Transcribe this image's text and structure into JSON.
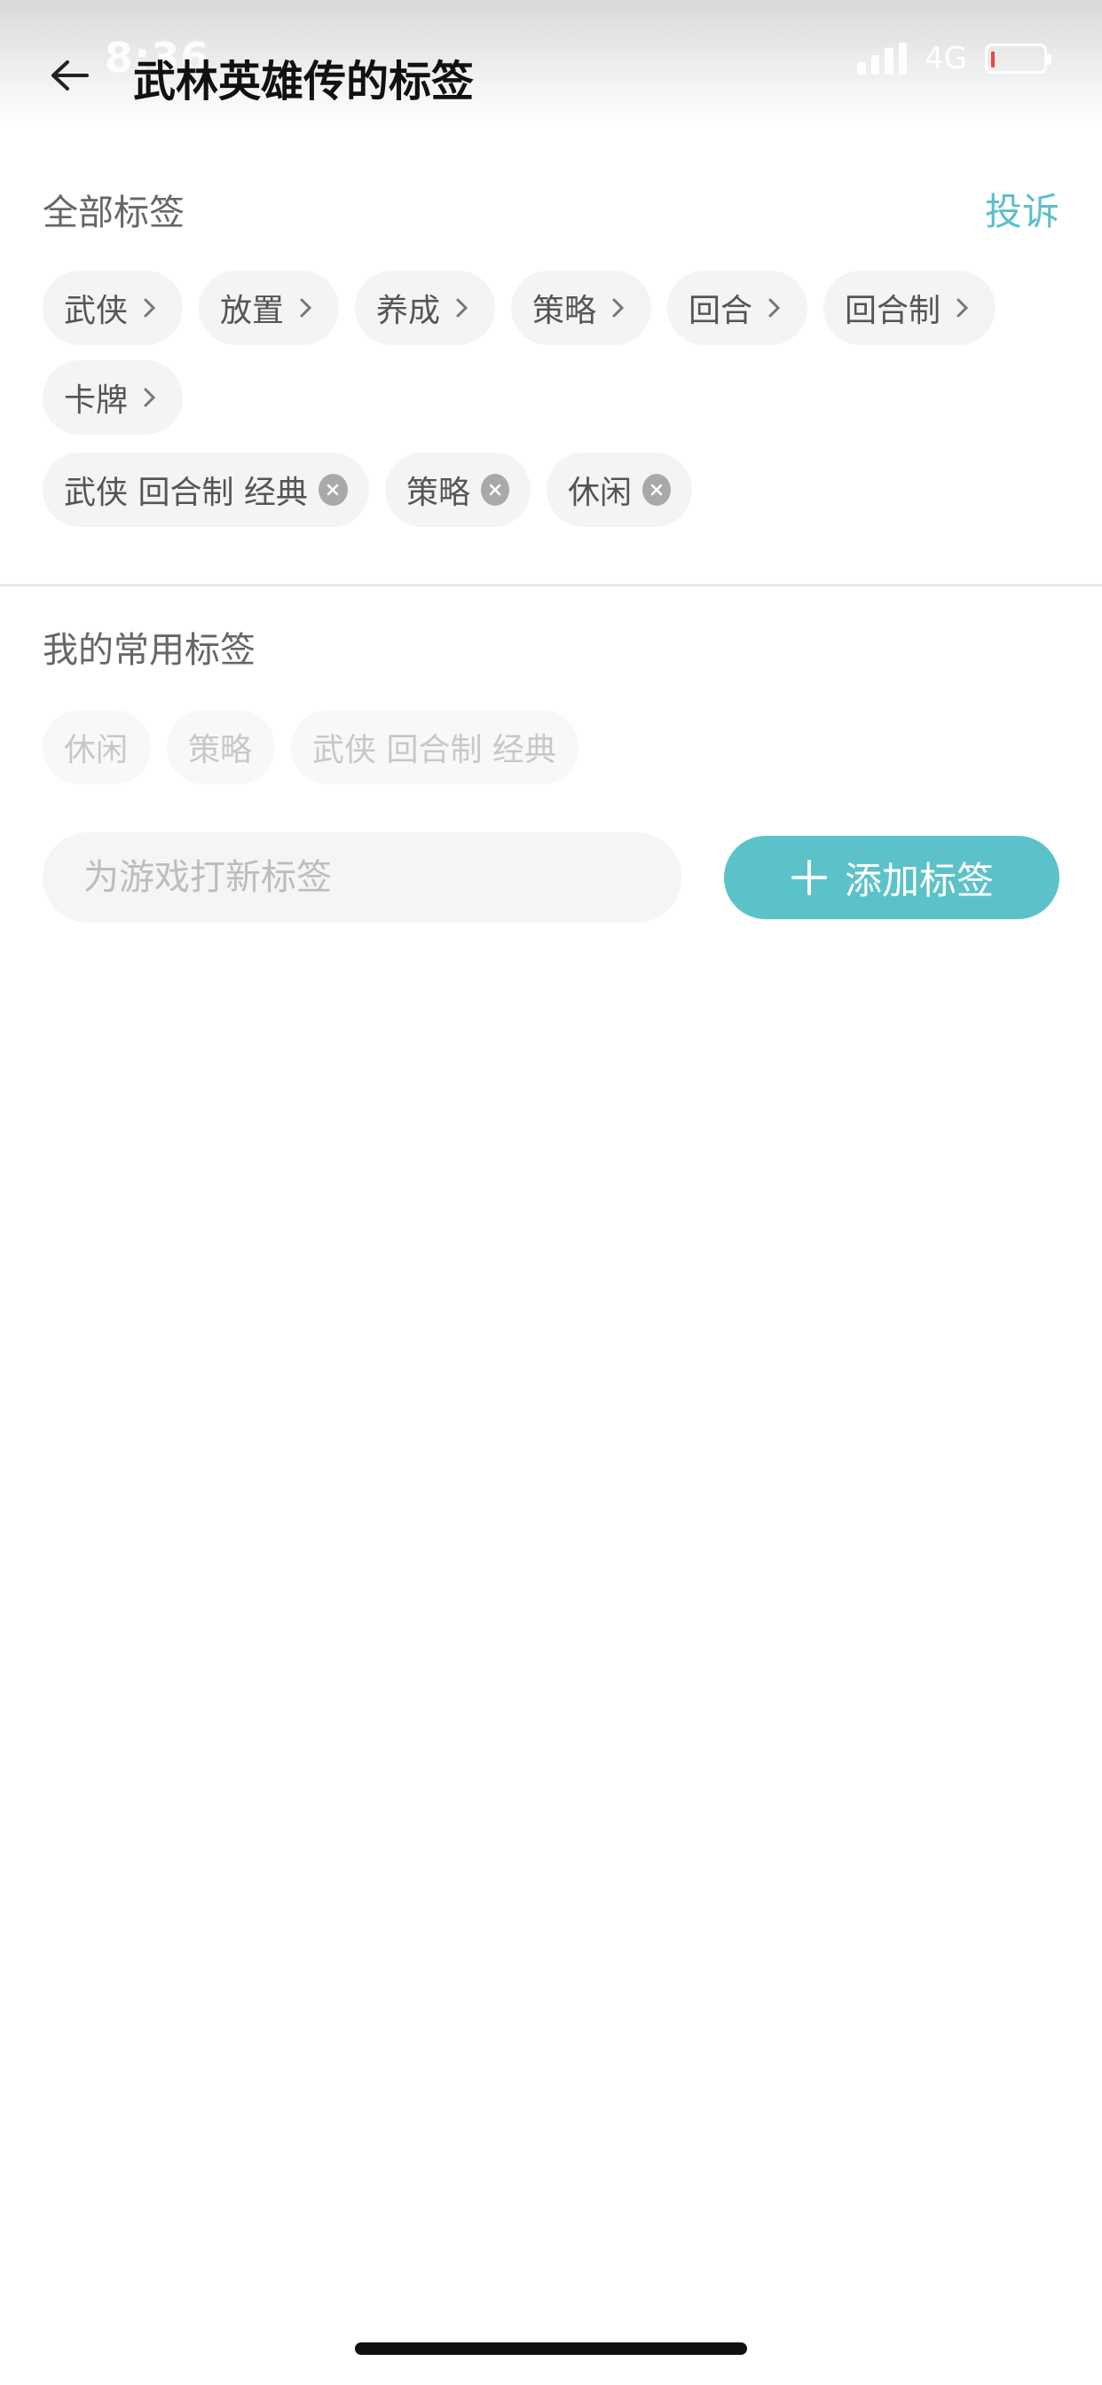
{
  "status_bar": {
    "time": "8:36",
    "network": "4G",
    "battery_color": "#e84545"
  },
  "nav": {
    "back_icon": "arrow-left-icon",
    "title": "武林英雄传的标签"
  },
  "all_tags": {
    "title": "全部标签",
    "report_label": "投诉",
    "tags": [
      {
        "label": "武侠"
      },
      {
        "label": "放置"
      },
      {
        "label": "养成"
      },
      {
        "label": "策略"
      },
      {
        "label": "回合"
      },
      {
        "label": "回合制"
      },
      {
        "label": "卡牌"
      }
    ],
    "removable_tags": [
      {
        "label": "武侠 回合制 经典"
      },
      {
        "label": "策略"
      },
      {
        "label": "休闲"
      }
    ]
  },
  "common_tags": {
    "title": "我的常用标签",
    "tags": [
      {
        "label": "休闲"
      },
      {
        "label": "策略"
      },
      {
        "label": "武侠 回合制 经典"
      }
    ]
  },
  "add_tag": {
    "placeholder": "为游戏打新标签",
    "button_label": "添加标签",
    "button_icon": "plus-icon"
  },
  "colors": {
    "accent": "#5cc2c9",
    "chip_bg": "#f3f4f6"
  }
}
